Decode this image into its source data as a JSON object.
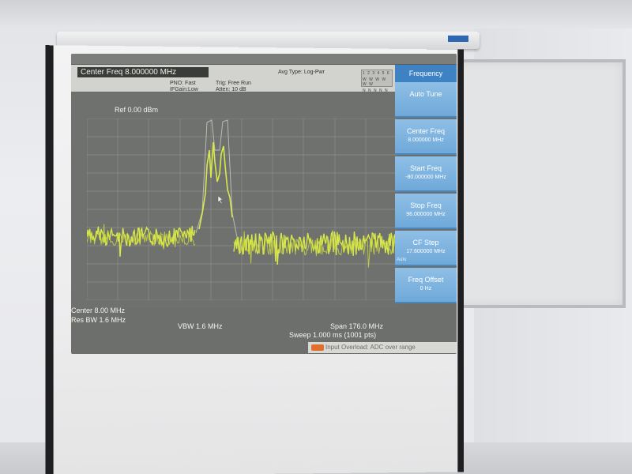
{
  "analyzer": {
    "center_freq_banner": "Center Freq 8.000000 MHz",
    "pno": "PNO: Fast",
    "if_gain": "IFGain:Low",
    "trig": "Trig: Free Run",
    "atten": "Atten: 10 dB",
    "avg_type": "Avg Type: Log-Pwr",
    "ref_level": "Ref 0.00 dBm",
    "center": "Center 8.00 MHz",
    "res_bw": "Res BW 1.6 MHz",
    "vbw": "VBW 1.6 MHz",
    "span": "Span 176.0 MHz",
    "sweep": "Sweep  1.000 ms (1001 pts)",
    "warning": "Input Overload: ADC over range"
  },
  "softkeys": {
    "title": "Frequency",
    "auto_tune": "Auto Tune",
    "center_freq": "Center Freq",
    "center_freq_val": "8.000000 MHz",
    "start_freq": "Start Freq",
    "start_freq_val": "-80.000000 MHz",
    "stop_freq": "Stop Freq",
    "stop_freq_val": "96.000000 MHz",
    "cf_step": "CF Step",
    "cf_step_val": "17.600000 MHz",
    "cf_step_mode": "Auto",
    "freq_offset": "Freq Offset",
    "freq_offset_val": "0 Hz"
  },
  "colors": {
    "trace": "#d8e84a",
    "softkey_blue": "#7ab4e0",
    "warning_badge": "#e36d2d"
  }
}
